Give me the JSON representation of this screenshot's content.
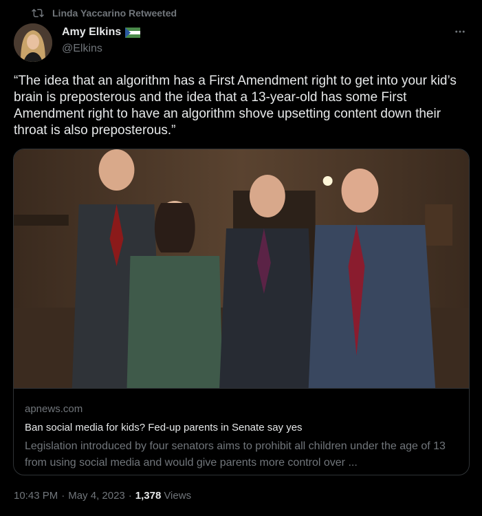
{
  "retweet": {
    "icon": "retweet-icon",
    "label": "Linda Yaccarino Retweeted"
  },
  "author": {
    "name": "Amy Elkins",
    "handle": "@Elkins",
    "badge_icon": "flag-icon"
  },
  "tweet": {
    "text": "“The idea that an algorithm has a First Amendment right to get into your kid’s brain is preposterous and the idea that a 13-year-old has some First Amendment right to have an algorithm shove upsetting content down their throat is also preposterous.”"
  },
  "card": {
    "image_alt": "Four senators standing together in a wood-paneled room",
    "domain": "apnews.com",
    "title": "Ban social media for kids? Fed-up parents in Senate say yes",
    "description": "Legislation introduced by four senators aims to prohibit all children under the age of 13 from using social media and would give parents more control over ..."
  },
  "footer": {
    "time": "10:43 PM",
    "date": "May 4, 2023",
    "views_count": "1,378",
    "views_label": "Views",
    "separator": "·"
  },
  "colors": {
    "background": "#000000",
    "text": "#e7e9ea",
    "muted": "#71767b",
    "border": "#2f3336"
  }
}
